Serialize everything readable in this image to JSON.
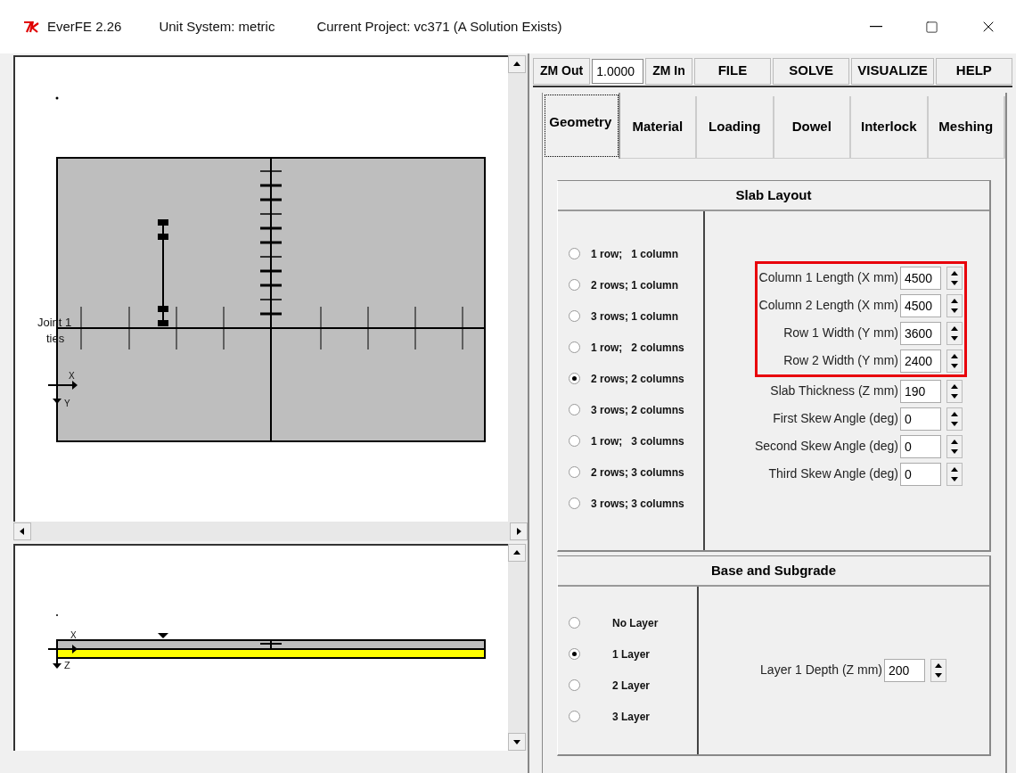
{
  "window": {
    "app": "EverFE 2.26",
    "unit_system": "Unit System: metric",
    "project": "Current Project: vc371 (A Solution Exists)"
  },
  "plan_view": {
    "joint_label": "Joint 1",
    "ties_label": "ties",
    "x_label": "X",
    "y_label": "Y"
  },
  "section_view": {
    "x_label": "X",
    "z_label": "Z"
  },
  "toolbar": {
    "zoom_out": "ZM Out",
    "zoom_value": "1.0000",
    "zoom_in": "ZM In",
    "menus": [
      "FILE",
      "SOLVE",
      "VISUALIZE",
      "HELP"
    ]
  },
  "tabs": [
    {
      "label": "Geometry",
      "selected": true
    },
    {
      "label": "Material",
      "selected": false
    },
    {
      "label": "Loading",
      "selected": false
    },
    {
      "label": "Dowel",
      "selected": false
    },
    {
      "label": "Interlock",
      "selected": false
    },
    {
      "label": "Meshing",
      "selected": false
    }
  ],
  "slab_layout": {
    "title": "Slab Layout",
    "options": [
      {
        "label": "1 row;   1 column",
        "selected": false
      },
      {
        "label": "2 rows; 1 column",
        "selected": false
      },
      {
        "label": "3 rows; 1 column",
        "selected": false
      },
      {
        "label": "1 row;   2 columns",
        "selected": false
      },
      {
        "label": "2 rows; 2 columns",
        "selected": true
      },
      {
        "label": "3 rows; 2 columns",
        "selected": false
      },
      {
        "label": "1 row;   3 columns",
        "selected": false
      },
      {
        "label": "2 rows; 3 columns",
        "selected": false
      },
      {
        "label": "3 rows; 3 columns",
        "selected": false
      }
    ],
    "fields": [
      {
        "label": "Column 1 Length (X mm)",
        "value": "4500",
        "highlighted": true
      },
      {
        "label": "Column 2 Length (X mm)",
        "value": "4500",
        "highlighted": true
      },
      {
        "label": "Row 1 Width (Y mm)",
        "value": "3600",
        "highlighted": true
      },
      {
        "label": "Row 2 Width (Y mm)",
        "value": "2400",
        "highlighted": true
      },
      {
        "label": "Slab Thickness (Z mm)",
        "value": "190",
        "highlighted": false
      },
      {
        "label": "First Skew Angle (deg)",
        "value": "0",
        "highlighted": false
      },
      {
        "label": "Second Skew Angle (deg)",
        "value": "0",
        "highlighted": false
      },
      {
        "label": "Third Skew Angle (deg)",
        "value": "0",
        "highlighted": false
      }
    ]
  },
  "base_subgrade": {
    "title": "Base and Subgrade",
    "options": [
      {
        "label": "No Layer",
        "selected": false
      },
      {
        "label": "1 Layer",
        "selected": true
      },
      {
        "label": "2 Layer",
        "selected": false
      },
      {
        "label": "3 Layer",
        "selected": false
      }
    ],
    "fields": [
      {
        "label": "Layer 1 Depth (Z mm)",
        "value": "200"
      }
    ]
  }
}
